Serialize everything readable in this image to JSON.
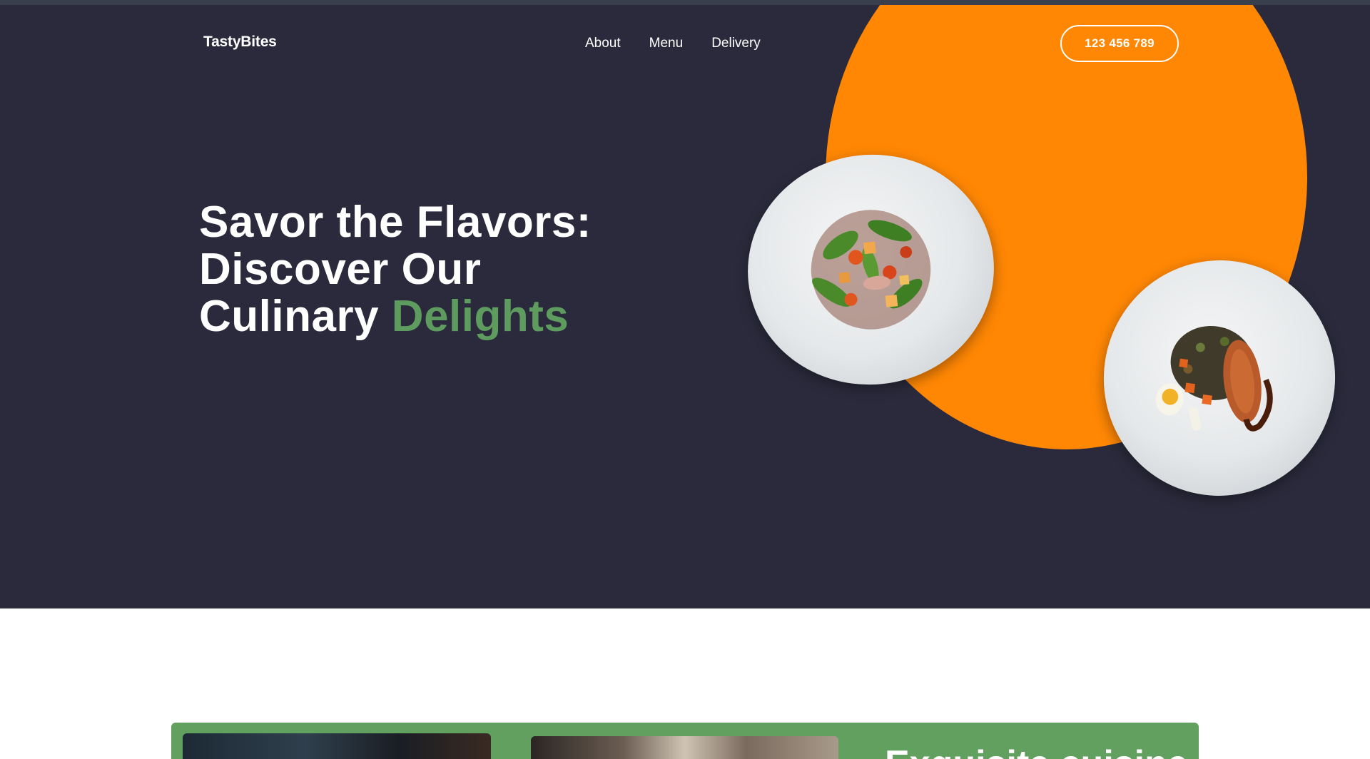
{
  "header": {
    "logo": "TastyBites",
    "nav": [
      {
        "label": "About"
      },
      {
        "label": "Menu"
      },
      {
        "label": "Delivery"
      }
    ],
    "phone_button": "123 456 789"
  },
  "hero": {
    "headline_line1": "Savor the Flavors:",
    "headline_line2": "Discover Our",
    "headline_line3_prefix": "Culinary",
    "headline_line3_accent": "Delights",
    "images": [
      {
        "name": "salad-plate",
        "description_icon": "salad-plate-image"
      },
      {
        "name": "salmon-plate",
        "description_icon": "salmon-plate-image"
      }
    ]
  },
  "promo": {
    "title": "Exquisite cuisine"
  },
  "colors": {
    "hero_bg": "#2b2a3c",
    "accent_orange": "#ff8704",
    "accent_green": "#5e9b5e",
    "promo_green": "#62a060"
  }
}
